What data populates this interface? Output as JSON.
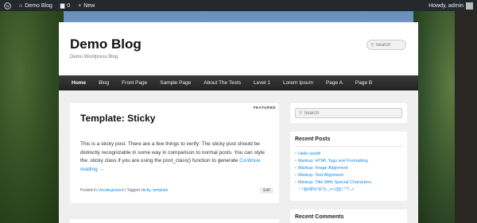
{
  "adminbar": {
    "site_name": "Demo Blog",
    "comments_count": "0",
    "new_label": "New",
    "greeting": "Howdy, admin"
  },
  "header": {
    "title": "Demo Blog",
    "description": "Demo Wordpress Blog",
    "search_placeholder": "Search"
  },
  "nav": {
    "items": [
      "Home",
      "Blog",
      "Front Page",
      "Sample Page",
      "About The Tests",
      "Level 1",
      "Lorem Ipsum",
      "Page A",
      "Page B"
    ]
  },
  "post": {
    "featured_label": "FEATURED",
    "title": "Template: Sticky",
    "body": "This is a sticky post. There are a few things to verify: The sticky post should be distinctly recognizable in some way in comparison to normal posts. You can style the .sticky class if you are using the post_class() function to generate",
    "more_link": "Continue reading →",
    "meta_posted_in": "Posted in",
    "category": "Uncategorized",
    "meta_tagged": "| Tagged",
    "tag1": "sticky",
    "tag_sep": ",",
    "tag2": "template",
    "edit_label": "Edit"
  },
  "sidebar": {
    "search_placeholder": "Search",
    "recent_posts_title": "Recent Posts",
    "recent_posts": [
      "Hello world!",
      "Markup: HTML Tags and Formatting",
      "Markup: Image Alignment",
      "Markup: Text Alignment",
      "Markup: Title With Special Characters",
      "~`!@#$%^&*()-_=+{}[]/;:'\"?,.>"
    ],
    "recent_comments_title": "Recent Comments"
  },
  "colors": {
    "admin_bar": "#23282d",
    "nav_bar": "#222222",
    "link": "#1b8be0"
  }
}
